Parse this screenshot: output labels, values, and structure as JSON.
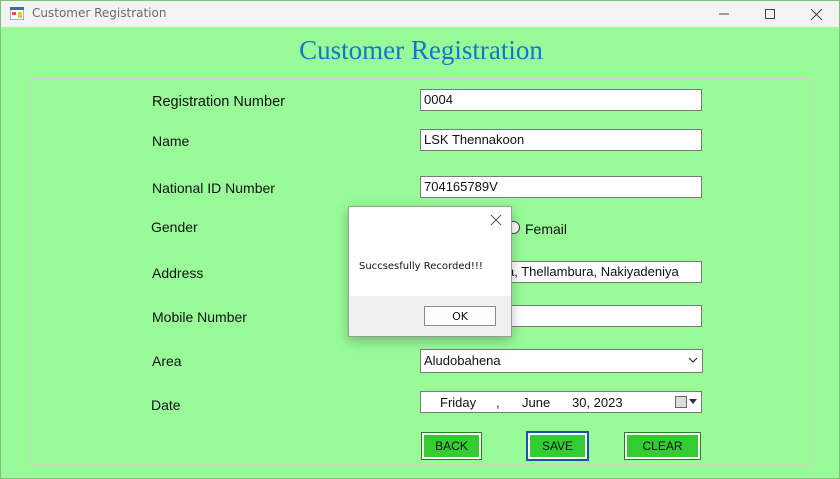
{
  "window": {
    "title": "Customer Registration",
    "minimize_icon": "minimize-icon",
    "maximize_icon": "maximize-icon",
    "close_icon": "close-icon"
  },
  "form": {
    "heading": "Customer Registration",
    "title_color": "#1177cc",
    "background_color": "#98fb98",
    "labels": {
      "registration_number": "Registration Number",
      "name": "Name",
      "national_id": "National ID Number",
      "gender": "Gender",
      "address": "Address",
      "mobile": "Mobile Number",
      "area": "Area",
      "date": "Date"
    },
    "values": {
      "registration_number": "0004",
      "name": "LSK Thennakoon",
      "national_id": "704165789V",
      "address": "a, Thellambura, Nakiyadeniya",
      "mobile": "",
      "area": "Aludobahena"
    },
    "gender_option_female": "Femail",
    "date": {
      "weekday": "Friday",
      "sep": ",",
      "month": "June",
      "day_year": "30, 2023"
    },
    "buttons": {
      "back": "BACK",
      "save": "SAVE",
      "clear": "CLEAR"
    },
    "button_color": "#33cc33"
  },
  "dialog": {
    "message": "Succsesfully Recorded!!!",
    "ok_label": "OK"
  }
}
